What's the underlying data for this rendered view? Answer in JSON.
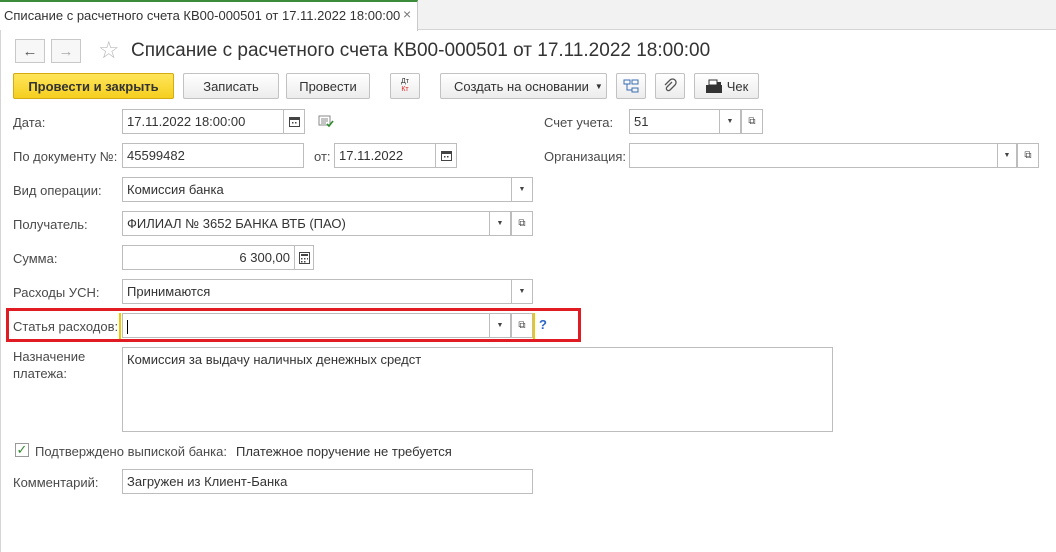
{
  "tab": {
    "title": "Списание с расчетного счета КВ00-000501 от 17.11.2022 18:00:00",
    "close": "×"
  },
  "nav": {
    "back": "←",
    "forward": "→",
    "star": "☆"
  },
  "header": {
    "title": "Списание с расчетного счета КВ00-000501 от 17.11.2022 18:00:00"
  },
  "toolbar": {
    "post_close": "Провести и закрыть",
    "save": "Записать",
    "post": "Провести",
    "dtkt_top": "Дт",
    "dtkt_bottom": "Кт",
    "create_based": "Создать на основании",
    "check": "Чек"
  },
  "form": {
    "date_label": "Дата:",
    "date_value": "17.11.2022 18:00:00",
    "account_label": "Счет учета:",
    "account_value": "51",
    "doc_num_label": "По документу №:",
    "doc_num_value": "45599482",
    "from_label": "от:",
    "from_value": "17.11.2022",
    "org_label": "Организация:",
    "org_value": "",
    "op_type_label": "Вид операции:",
    "op_type_value": "Комиссия банка",
    "recipient_label": "Получатель:",
    "recipient_value": "ФИЛИАЛ № 3652 БАНКА ВТБ (ПАО)",
    "sum_label": "Сумма:",
    "sum_value": "6 300,00",
    "usn_label": "Расходы УСН:",
    "usn_value": "Принимаются",
    "expense_label": "Статья расходов:",
    "expense_value": "",
    "expense_help": "?",
    "purpose_label_1": "Назначение",
    "purpose_label_2": "платежа:",
    "purpose_value": "Комиссия за выдачу наличных денежных средст",
    "confirmed_label": "Подтверждено выпиской банка:",
    "confirmed_checked": true,
    "payment_order_note": "Платежное поручение не требуется",
    "comment_label": "Комментарий:",
    "comment_value": "Загружен из Клиент-Банка"
  },
  "colors": {
    "primary_button": "#f5cf1f",
    "highlight_border": "#e01b24",
    "check_green": "#2e8b2e"
  }
}
